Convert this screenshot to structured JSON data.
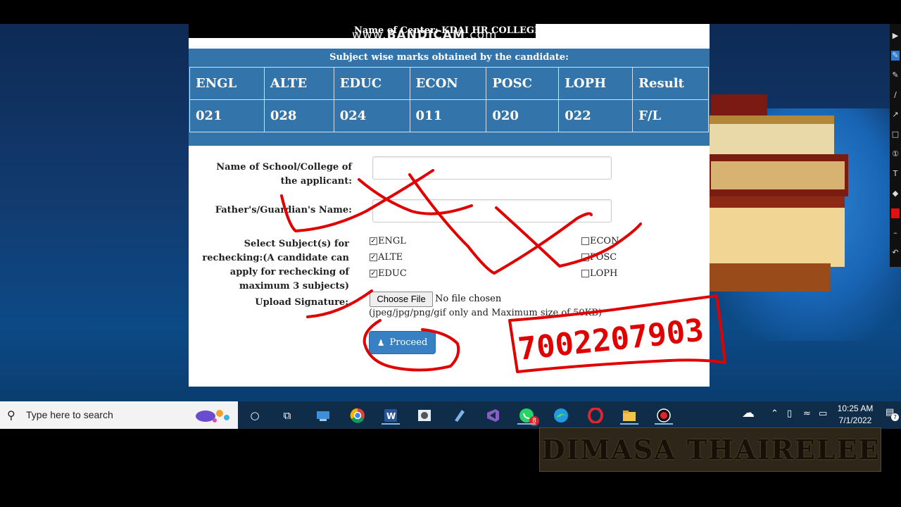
{
  "recording_watermark": {
    "prefix": "www.",
    "brand": "BANDICAM",
    "suffix": ".com"
  },
  "center": {
    "name": "Name of Center: KDAI HR COLLEGE"
  },
  "marks": {
    "caption": "Subject wise marks obtained by the candidate:",
    "headers": [
      "ENGL",
      "ALTE",
      "EDUC",
      "ECON",
      "POSC",
      "LOPH",
      "Result"
    ],
    "values": [
      "021",
      "028",
      "024",
      "011",
      "020",
      "022",
      "F/L"
    ]
  },
  "form": {
    "school_label": "Name of School/College of the applicant:",
    "school_value": "",
    "father_label": "Father's/Guardian's Name:",
    "father_value": "",
    "subjects_label": "Select Subject(s) for rechecking:(A candidate can apply for rechecking of maximum 3 subjects)",
    "subjects": [
      {
        "name": "ENGL",
        "checked": true
      },
      {
        "name": "ALTE",
        "checked": true
      },
      {
        "name": "EDUC",
        "checked": true
      },
      {
        "name": "ECON",
        "checked": false
      },
      {
        "name": "POSC",
        "checked": false
      },
      {
        "name": "LOPH",
        "checked": false
      }
    ],
    "signature_label": "Upload Signature:",
    "choose_file_label": "Choose File",
    "file_status": "No file chosen",
    "file_hint": "(jpeg/jpg/png/gif only and Maximum size of 50KB)",
    "proceed_label": "Proceed"
  },
  "annotation": {
    "handwritten_number": "7002207903",
    "ink_color": "#e00000"
  },
  "taskbar": {
    "search_placeholder": "Type here to search",
    "apps": [
      "cortana-icon",
      "task-view-icon",
      "network-app-icon",
      "chrome-icon",
      "word-icon",
      "photos-icon",
      "pen-app-icon",
      "visual-studio-icon",
      "whatsapp-icon",
      "edge-icon",
      "opera-icon",
      "file-explorer-icon",
      "bandicam-record-icon"
    ],
    "whatsapp_badge": "8",
    "time": "10:25 AM",
    "date": "7/1/2022",
    "notification_count": "7"
  },
  "channel": {
    "name": "DIMASA THAIRELEE"
  }
}
